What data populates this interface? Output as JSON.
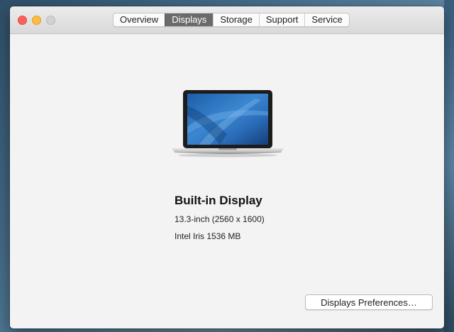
{
  "window": {
    "tabs": [
      {
        "label": "Overview"
      },
      {
        "label": "Displays",
        "selected": true
      },
      {
        "label": "Storage"
      },
      {
        "label": "Support"
      },
      {
        "label": "Service"
      }
    ]
  },
  "display": {
    "name": "Built-in Display",
    "size_resolution": "13.3-inch (2560 x 1600)",
    "graphics": "Intel Iris 1536 MB"
  },
  "actions": {
    "preferences_label": "Displays Preferences…"
  },
  "icons": [
    "macbook-pro-icon"
  ],
  "colors": {
    "selected_tab": "#6a6a6a",
    "close": "#fc605c",
    "minimize": "#fdbc40",
    "zoom_disabled": "#d2d2d2"
  }
}
